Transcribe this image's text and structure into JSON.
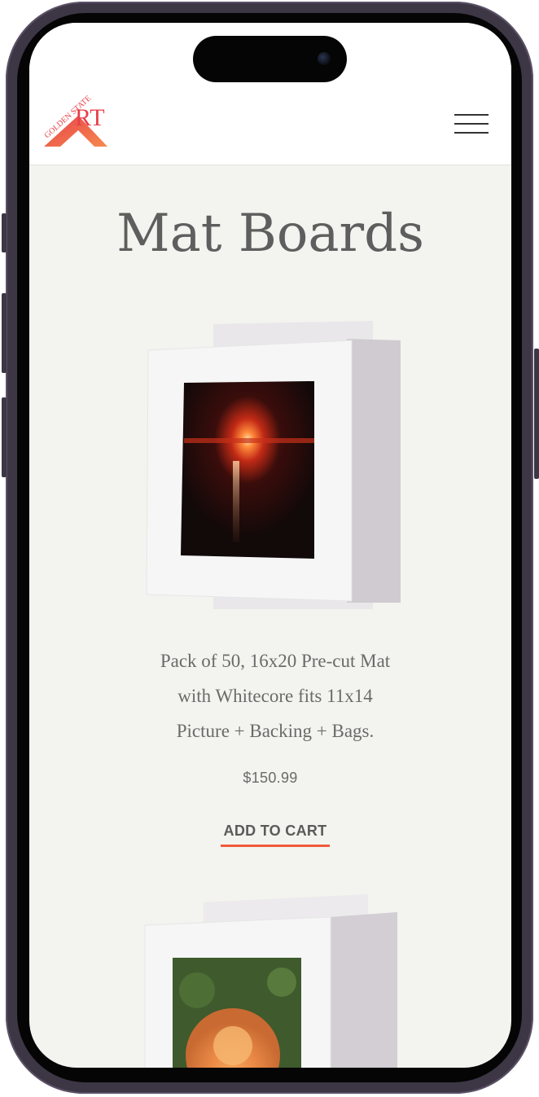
{
  "brand": {
    "name": "Golden State Art",
    "logo_text": "GOLDEN STATE",
    "logo_mark": "ART"
  },
  "page": {
    "title": "Mat Boards"
  },
  "products": [
    {
      "image": "sunset-photo-in-white-mat",
      "description_lines": [
        "Pack of 50, 16x20 Pre-cut Mat",
        "with Whitecore fits 11x14",
        "Picture + Backing + Bags."
      ],
      "price": "$150.99",
      "cta": "ADD TO CART"
    },
    {
      "image": "orange-rose-photo-in-white-mat"
    }
  ],
  "icons": {
    "menu": "hamburger-menu-icon",
    "camera": "front-camera-icon"
  },
  "colors": {
    "accent": "#f05a3c",
    "background": "#f3f3ef",
    "logo_red": "#e8404a",
    "logo_orange": "#f27a4a"
  }
}
